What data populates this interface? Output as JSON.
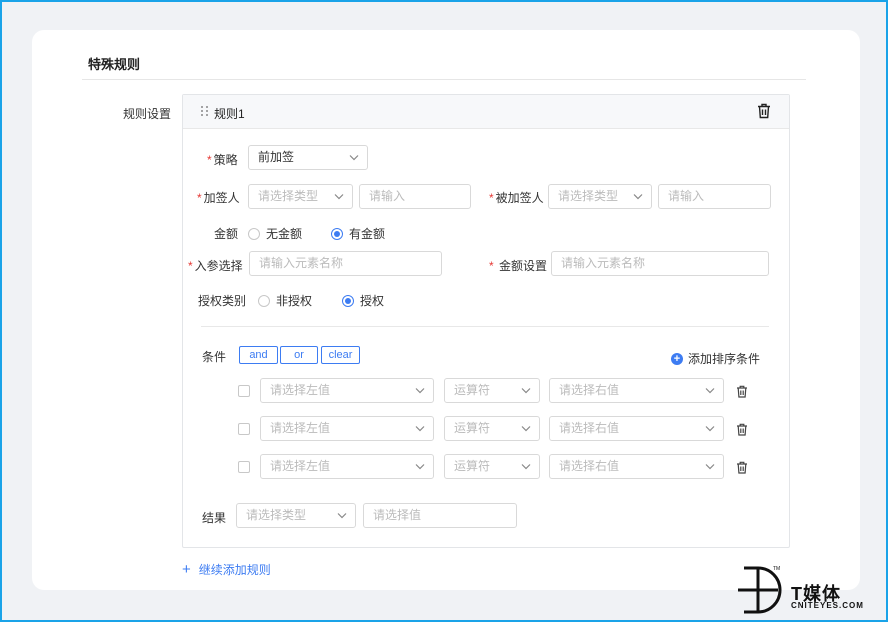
{
  "section": {
    "title": "特殊规则",
    "row_label": "规则设置"
  },
  "rule": {
    "name": "规则1",
    "strategy": {
      "label": "策略",
      "value": "前加签"
    },
    "signer": {
      "label": "加签人",
      "type_placeholder": "请选择类型",
      "input_placeholder": "请输入"
    },
    "signee": {
      "label": "被加签人",
      "type_placeholder": "请选择类型",
      "input_placeholder": "请输入"
    },
    "amount": {
      "label": "金额",
      "options": [
        "无金额",
        "有金额"
      ],
      "selected": "有金额"
    },
    "param_select": {
      "label": "入参选择",
      "placeholder": "请输入元素名称"
    },
    "amount_setting": {
      "label": "金额设置",
      "placeholder": "请输入元素名称"
    },
    "auth_type": {
      "label": "授权类别",
      "options": [
        "非授权",
        "授权"
      ],
      "selected": "授权"
    },
    "conditions": {
      "label": "条件",
      "logic_buttons": [
        "and",
        "or",
        "clear"
      ],
      "add_sort_label": "添加排序条件",
      "rows": [
        {
          "left_placeholder": "请选择左值",
          "op_placeholder": "运算符",
          "right_placeholder": "请选择右值"
        },
        {
          "left_placeholder": "请选择左值",
          "op_placeholder": "运算符",
          "right_placeholder": "请选择右值"
        },
        {
          "left_placeholder": "请选择左值",
          "op_placeholder": "运算符",
          "right_placeholder": "请选择右值"
        }
      ]
    },
    "result": {
      "label": "结果",
      "type_placeholder": "请选择类型",
      "value_placeholder": "请选择值"
    }
  },
  "add_rule_label": "继续添加规则",
  "watermark": {
    "tm": "TM",
    "name": "T媒体",
    "domain": "CNITEYES.COM"
  },
  "colors": {
    "accent": "#3d7cf2",
    "required": "#e53935",
    "frame": "#1aa3e8"
  },
  "icons": [
    "drag-handle-icon",
    "trash-icon",
    "chevron-down-icon",
    "plus-circle-icon",
    "plus-icon",
    "t-logo-icon"
  ]
}
